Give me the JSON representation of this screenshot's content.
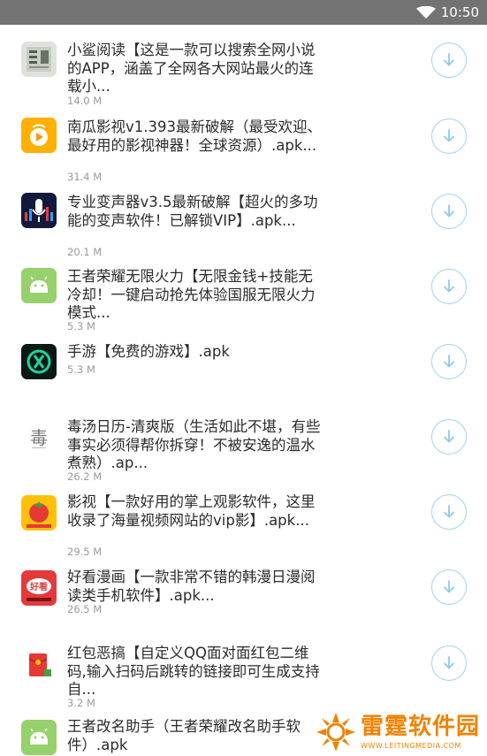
{
  "status_bar": {
    "time": "10:50",
    "wifi_icon": "wifi-icon"
  },
  "colors": {
    "status_bar_bg": "#737373",
    "download_ring": "#9fd3ec",
    "title_text": "#2b2b2b",
    "size_text": "#9a9a9a",
    "watermark_orange": "#f08300"
  },
  "items": [
    {
      "title": "小鲨阅读【这是一款可以搜索全网小说的APP，涵盖了全网各大网站最火的连载小...",
      "size": "14.0 M",
      "icon": "xiaosha-reader-icon"
    },
    {
      "title": "南瓜影视v1.393最新破解（最受欢迎、最好用的影视神器！全球资源）.apk...",
      "size": "31.4 M",
      "icon": "pumpkin-video-icon"
    },
    {
      "title": "专业变声器v3.5最新破解【超火的多功能的变声软件！已解锁VIP】.apk...",
      "size": "20.1 M",
      "icon": "microphone-icon"
    },
    {
      "title": "王者荣耀无限火力【无限金钱+技能无冷却！一键启动抢先体验国服无限火力模式...",
      "size": "5.3 M",
      "icon": "android-icon"
    },
    {
      "title": "手游【免费的游戏】.apk",
      "size": "5.3 M",
      "icon": "game-icon"
    },
    {
      "title": "毒汤日历-清爽版（生活如此不堪，有些事实必须得帮你拆穿！不被安逸的温水煮熟）.ap...",
      "size": "26.2 M",
      "icon": "calendar-icon"
    },
    {
      "title": "影视【一款好用的掌上观影软件，这里收录了海量视频网站的vip影】.apk...",
      "size": "29.5 M",
      "icon": "tomato-video-icon"
    },
    {
      "title": "好看漫画【一款非常不错的韩漫日漫阅读类手机软件】.apk...",
      "size": "26.5 M",
      "icon": "comic-icon"
    },
    {
      "title": "红包恶搞【自定义QQ面对面红包二维码,输入扫码后跳转的链接即可生成支持自...",
      "size": "3.2 M",
      "icon": "red-envelope-icon"
    },
    {
      "title": "王者改名助手（王者荣耀改名助手软件）.apk",
      "size": "",
      "icon": "android-icon"
    }
  ],
  "watermark": {
    "name": "雷霆软件园",
    "url": "WWW.LEITINGMEDIA.COM"
  }
}
